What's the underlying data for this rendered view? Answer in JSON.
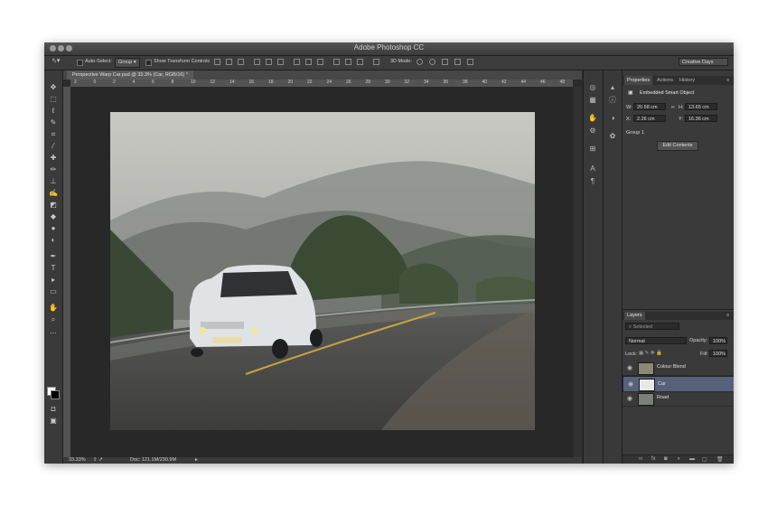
{
  "app": {
    "title": "Adobe Photoshop CC"
  },
  "options_bar": {
    "auto_select_label": "Auto-Select:",
    "auto_select_value": "Group",
    "show_transform_label": "Show Transform Controls",
    "mode_3d_label": "3D Mode:",
    "workspace": "Creative Days"
  },
  "document": {
    "tab_title": "Perspective Warp Car.psd @ 33.3% (Car, RGB/16) *",
    "ruler_h": [
      "2",
      "0",
      "2",
      "4",
      "6",
      "8",
      "10",
      "12",
      "14",
      "16",
      "18",
      "20",
      "22",
      "24",
      "26",
      "28",
      "30",
      "32",
      "34",
      "36",
      "38",
      "40",
      "42",
      "44",
      "46",
      "48"
    ]
  },
  "status_bar": {
    "zoom": "33.33%",
    "doc_info": "Doc: 121.1M/230.9M"
  },
  "properties": {
    "tabs": [
      "Properties",
      "Actions",
      "History"
    ],
    "header": "Embedded Smart Object",
    "w_label": "W:",
    "w_value": "20.58 cm",
    "h_label": "H:",
    "h_value": "13.65 cm",
    "x_label": "X:",
    "x_value": "2.26 cm",
    "y_label": "Y:",
    "y_value": "16.36 cm",
    "group": "Group 1",
    "edit_button": "Edit Contents"
  },
  "layers_panel": {
    "title": "Layers",
    "filter": "Selected",
    "blend_mode": "Normal",
    "opacity_label": "Opacity:",
    "opacity_value": "100%",
    "lock_label": "Lock:",
    "fill_label": "Fill:",
    "fill_value": "100%",
    "layers": [
      {
        "name": "Colour Blend",
        "selected": false
      },
      {
        "name": "Car",
        "selected": true
      },
      {
        "name": "Road",
        "selected": false
      }
    ]
  },
  "colors": {
    "accent_selected_layer": "#56627a",
    "window_bg": "#2b2b2b"
  }
}
